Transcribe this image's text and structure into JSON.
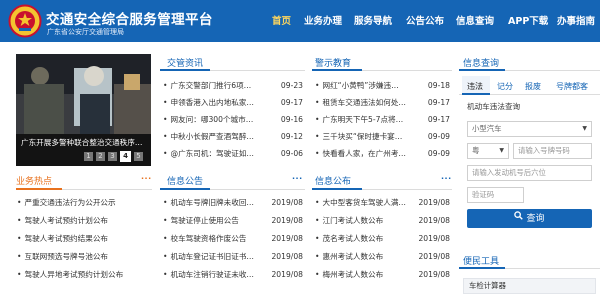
{
  "header": {
    "title": "交通安全综合服务管理平台",
    "subtitle": "广东省公安厅交通管理局",
    "nav": [
      "首页",
      "业务办理",
      "服务导航",
      "公告公布",
      "信息查询",
      "APP下载",
      "办事指南"
    ],
    "colors": {
      "bar": "#1565b5",
      "active": "#ffd75e"
    }
  },
  "banner": {
    "caption": "广东开展多警种联合整治交通秩序…",
    "pages": [
      "1",
      "2",
      "3",
      "4",
      "5"
    ],
    "active_page": "4"
  },
  "sections": {
    "traffic_news": {
      "title": "交管资讯",
      "items": [
        {
          "text": "广东交警部门推行6项…",
          "date": "09-23"
        },
        {
          "text": "申领香港入出内地私家…",
          "date": "09-17"
        },
        {
          "text": "网友问：哪300个城市…",
          "date": "09-16"
        },
        {
          "text": "中秋小长假严查酒驾醉…",
          "date": "09-12"
        },
        {
          "text": "@广东司机：驾驶证如…",
          "date": "09-06"
        }
      ]
    },
    "warning": {
      "title": "警示教育",
      "items": [
        {
          "text": "网红“小黄鸭”涉嫌违…",
          "date": "09-18"
        },
        {
          "text": "租赁车交通违法如何处…",
          "date": "09-17"
        },
        {
          "text": "广东明天下午5-7点将…",
          "date": "09-17"
        },
        {
          "text": "三千块买“保时捷卡宴…",
          "date": "09-09"
        },
        {
          "text": "快看看人家，在广州考…",
          "date": "09-09"
        }
      ]
    },
    "hot": {
      "title": "业务热点",
      "items": [
        "严重交通违法行为公开公示",
        "驾驶人考试预约计划公布",
        "驾驶人考试预约结果公布",
        "互联网预选号牌号池公布",
        "驾驶人异地考试预约计划公布"
      ]
    },
    "notice": {
      "title": "信息公告",
      "items": [
        {
          "text": "机动车号牌旧牌未收回…",
          "date": "2019/08"
        },
        {
          "text": "驾驶证停止使用公告",
          "date": "2019/08"
        },
        {
          "text": "校车驾驶资格作废公告",
          "date": "2019/08"
        },
        {
          "text": "机动车登记证书旧证书…",
          "date": "2019/08"
        },
        {
          "text": "机动车注销行驶证未收…",
          "date": "2019/08"
        }
      ]
    },
    "publish": {
      "title": "信息公布",
      "items": [
        {
          "text": "大中型客货车驾驶人满…",
          "date": "2019/08"
        },
        {
          "text": "江门考试人数公布",
          "date": "2019/08"
        },
        {
          "text": "茂名考试人数公布",
          "date": "2019/08"
        },
        {
          "text": "惠州考试人数公布",
          "date": "2019/08"
        },
        {
          "text": "梅州考试人数公布",
          "date": "2019/08"
        }
      ]
    }
  },
  "query": {
    "title": "信息查询",
    "tabs": [
      "违法",
      "记分",
      "报废",
      "号牌都客"
    ],
    "active_tab": "违法",
    "heading": "机动车违法查询",
    "vehicle_type": "小型汽车",
    "province": "粤",
    "plate_placeholder": "请输入号牌号码",
    "engine_placeholder": "请输入发动机号后六位",
    "captcha_placeholder": "验证码",
    "button": "查询"
  },
  "tools": {
    "title": "便民工具",
    "items": [
      "车检计算器"
    ]
  }
}
